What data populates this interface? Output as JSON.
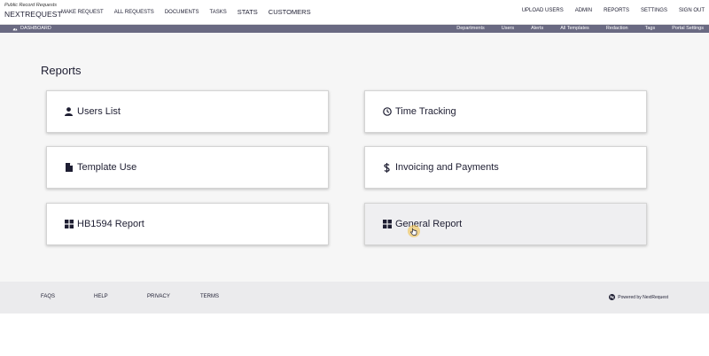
{
  "brand": {
    "subtitle": "Public Record Requests",
    "name": "NEXTREQUEST"
  },
  "nav": {
    "left": [
      {
        "label": "MAKE REQUEST",
        "big": false
      },
      {
        "label": "ALL REQUESTS",
        "big": false
      },
      {
        "label": "DOCUMENTS",
        "big": false
      },
      {
        "label": "TASKS",
        "big": false
      },
      {
        "label": "STATS",
        "big": true
      },
      {
        "label": "CUSTOMERS",
        "big": true
      }
    ],
    "right": [
      "UPLOAD USERS",
      "ADMIN",
      "REPORTS",
      "SETTINGS",
      "SIGN OUT"
    ]
  },
  "subnav": {
    "dashboard": "DASHBOARD",
    "items": [
      "Departments",
      "Users",
      "Alerts",
      "All Templates",
      "Redaction",
      "Tags",
      "Portal Settings"
    ]
  },
  "main": {
    "title": "Reports",
    "cards": [
      {
        "label": "Users List",
        "icon": "user-icon"
      },
      {
        "label": "Time Tracking",
        "icon": "clock-icon"
      },
      {
        "label": "Template Use",
        "icon": "file-icon"
      },
      {
        "label": "Invoicing and Payments",
        "icon": "dollar-icon"
      },
      {
        "label": "HB1594 Report",
        "icon": "grid-icon"
      },
      {
        "label": "General Report",
        "icon": "grid-icon"
      }
    ]
  },
  "footer": {
    "links": [
      "FAQS",
      "HELP",
      "PRIVACY",
      "TERMS"
    ],
    "powered": "Powered by NextRequest"
  },
  "colors": {
    "subnav": "#6a6a82",
    "text": "#1e1e32",
    "footer": "#ebebed"
  }
}
